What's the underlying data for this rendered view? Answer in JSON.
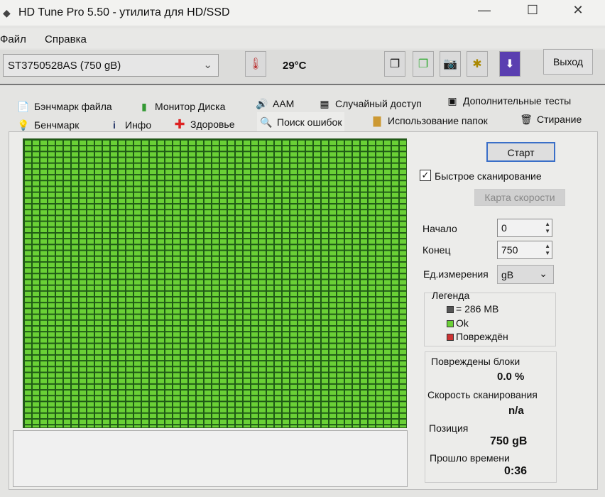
{
  "window": {
    "title": "HD Tune Pro 5.50 - утилита для HD/SSD",
    "minimize": "—",
    "maximize": "☐",
    "close": "✕"
  },
  "menu": [
    "Файл",
    "Справка"
  ],
  "toolbar": {
    "drive": "ST3750528AS (750 gB)",
    "temperature": "29°C",
    "exit": "Выход"
  },
  "tabs_row1": [
    "Бэнчмарк файла",
    "Монитор Диска",
    "AAM",
    "Случайный доступ",
    "Дополнительные  тесты"
  ],
  "tabs_row2": [
    "Бенчмарк",
    "Инфо",
    "Здоровье",
    "Поиск ошибок",
    "Использование папок",
    "Стирание"
  ],
  "active_tab": "Поиск ошибок",
  "scan_map": {
    "status": "ok",
    "color_ok": "#6ad036"
  },
  "panel": {
    "start": "Старт",
    "quick_scan_label": "Быстрое сканирование",
    "quick_scan_checked": true,
    "speed_map": "Карта скорости",
    "start_label": "Начало",
    "start_value": "0",
    "end_label": "Конец",
    "end_value": "750",
    "unit_label": "Ед.измерения",
    "unit_value": "gB",
    "legend_title": "Легенда",
    "legend_block": "= 286 MB",
    "legend_ok": "Ok",
    "legend_damaged": "Повреждён",
    "damaged_label": "Повреждены блоки",
    "damaged_value": "0.0 %",
    "speed_label": "Скорость сканирования",
    "speed_value": "n/a",
    "position_label": "Позиция",
    "position_value": "750 gB",
    "elapsed_label": "Прошло времени",
    "elapsed_value": "0:36"
  }
}
